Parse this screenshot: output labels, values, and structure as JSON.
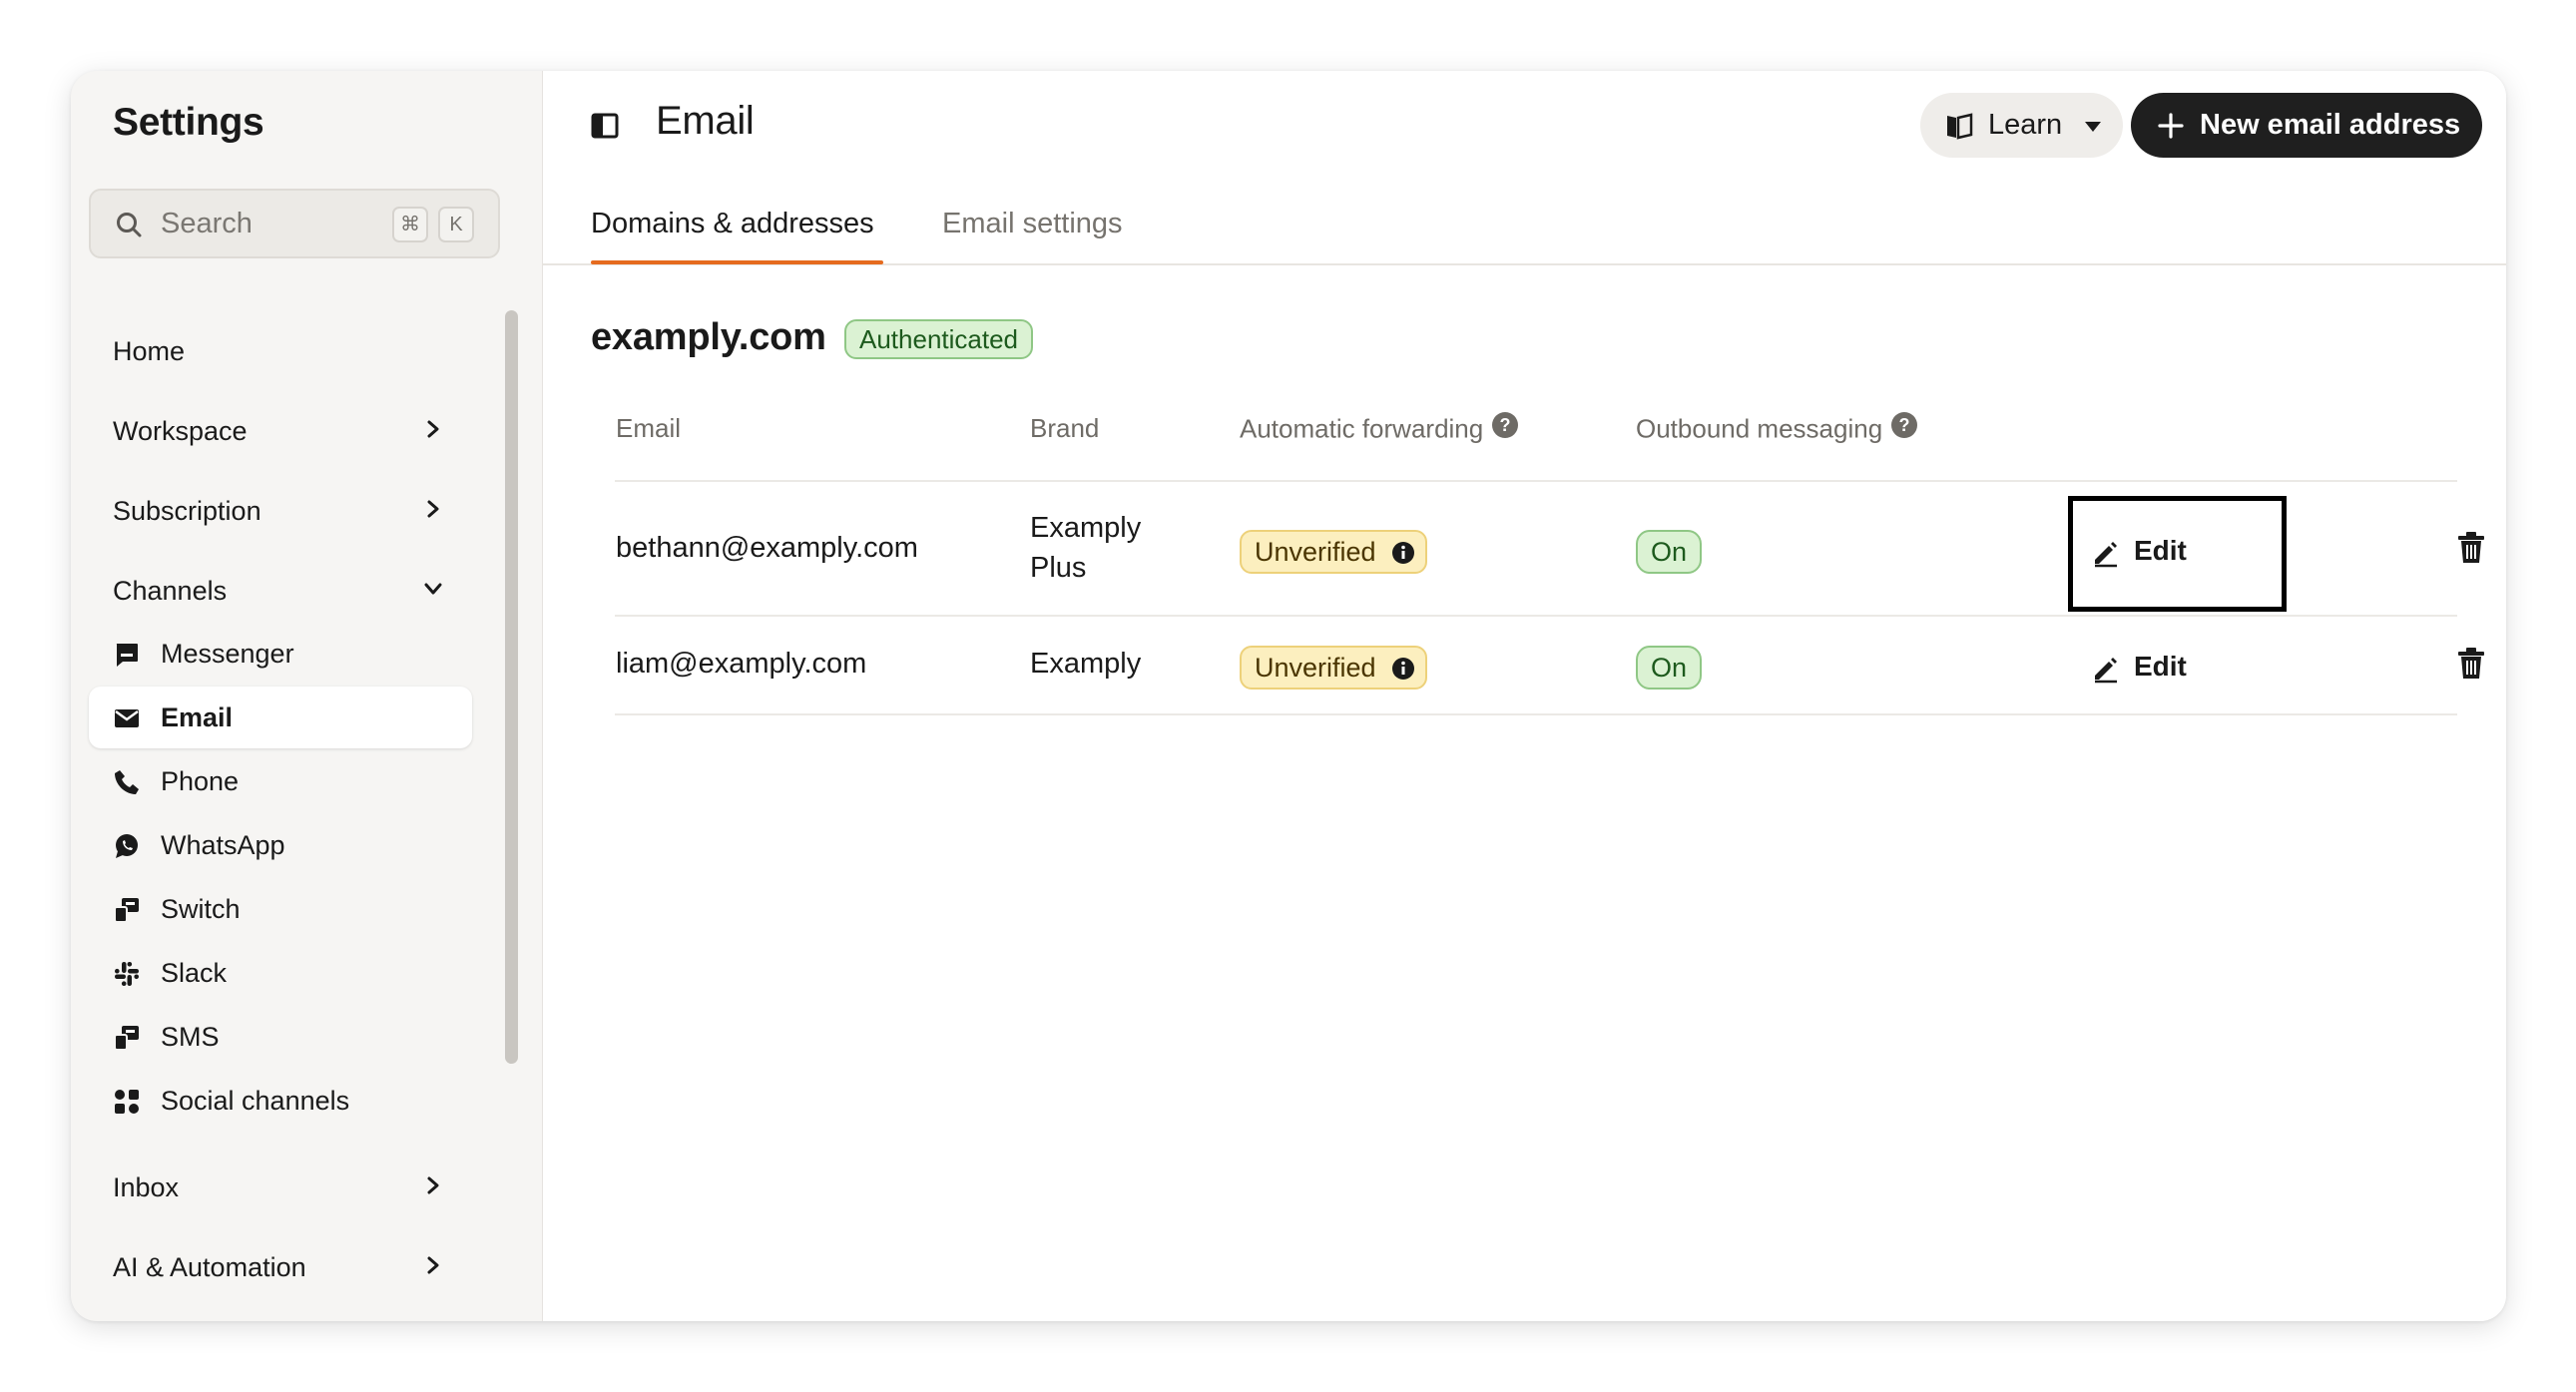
{
  "sidebar": {
    "title": "Settings",
    "search": {
      "placeholder": "Search",
      "shortcut_mod": "⌘",
      "shortcut_key": "K"
    },
    "nav": [
      {
        "label": "Home"
      },
      {
        "label": "Workspace"
      },
      {
        "label": "Subscription"
      },
      {
        "label": "Channels"
      },
      {
        "label": "Inbox"
      },
      {
        "label": "AI & Automation"
      }
    ],
    "channels": [
      {
        "label": "Messenger",
        "icon": "messenger-icon"
      },
      {
        "label": "Email",
        "icon": "envelope-icon",
        "active": true
      },
      {
        "label": "Phone",
        "icon": "phone-icon"
      },
      {
        "label": "WhatsApp",
        "icon": "whatsapp-icon"
      },
      {
        "label": "Switch",
        "icon": "switch-icon"
      },
      {
        "label": "Slack",
        "icon": "slack-icon"
      },
      {
        "label": "SMS",
        "icon": "sms-icon"
      },
      {
        "label": "Social channels",
        "icon": "social-channels-icon"
      }
    ]
  },
  "header": {
    "title": "Email",
    "learn_label": "Learn",
    "new_button_label": "New email address"
  },
  "tabs": [
    {
      "label": "Domains & addresses",
      "active": true
    },
    {
      "label": "Email settings",
      "active": false
    }
  ],
  "domain": {
    "name": "examply.com",
    "status": "Authenticated"
  },
  "table": {
    "columns": [
      "Email",
      "Brand",
      "Automatic forwarding",
      "Outbound messaging"
    ],
    "rows": [
      {
        "email": "bethann@examply.com",
        "brand_line1": "Examply",
        "brand_line2": "Plus",
        "forwarding": "Unverified",
        "outbound": "On",
        "edit_label": "Edit"
      },
      {
        "email": "liam@examply.com",
        "brand_line1": "Examply",
        "brand_line2": "",
        "forwarding": "Unverified",
        "outbound": "On",
        "edit_label": "Edit"
      }
    ]
  },
  "colors": {
    "accent_tab": "#e56b1f",
    "primary_button": "#1f1f1f",
    "badge_green": "#dbf2d3",
    "badge_yellow": "#fcefbf"
  }
}
